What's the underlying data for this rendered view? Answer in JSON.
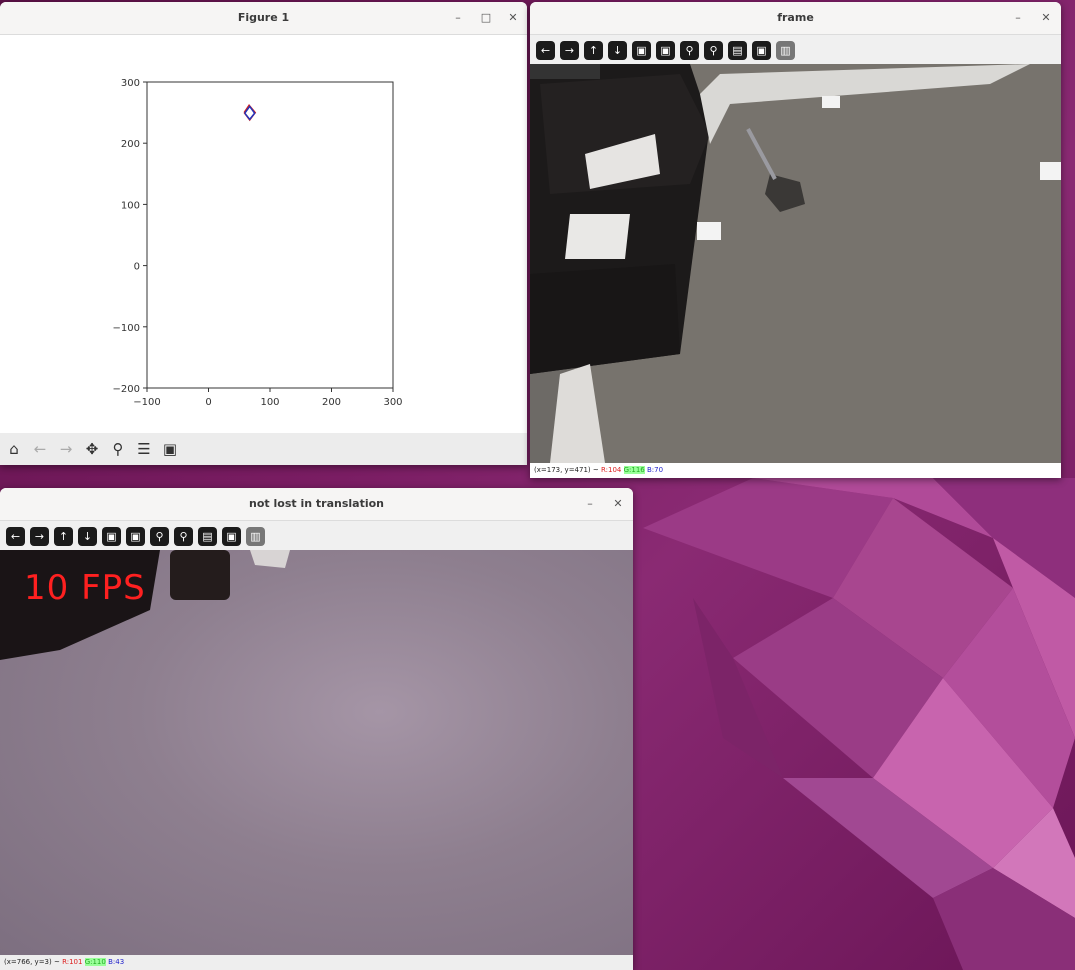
{
  "figure": {
    "title": "Figure 1",
    "controls": {
      "minimize": "–",
      "maximize": "□",
      "close": "✕"
    },
    "toolbar": [
      "home-icon",
      "back-icon",
      "forward-icon",
      "pan-icon",
      "zoom-icon",
      "configure-icon",
      "save-icon"
    ]
  },
  "chart_data": {
    "type": "line",
    "x_ticks": [
      "−100",
      "0",
      "100",
      "200",
      "300"
    ],
    "y_ticks": [
      "300",
      "200",
      "100",
      "0",
      "−100",
      "−200"
    ],
    "xlim": [
      -100,
      300
    ],
    "ylim": [
      -200,
      300
    ],
    "series": [
      {
        "color": "#cc2222",
        "x": [
          58,
          66,
          76,
          67,
          58
        ],
        "y": [
          250,
          262,
          250,
          238,
          250
        ]
      },
      {
        "color": "#2233bb",
        "x": [
          59,
          67,
          75,
          67,
          59
        ],
        "y": [
          249,
          260,
          249,
          239,
          249
        ]
      }
    ]
  },
  "frame": {
    "title": "frame",
    "controls": {
      "minimize": "–",
      "close": "✕"
    },
    "tools": [
      "←",
      "→",
      "↑",
      "↓",
      "▣",
      "▣",
      "⚲",
      "⚲",
      "▤",
      "▣",
      "▥"
    ],
    "status": {
      "coords": "(x=173, y=471) ~",
      "r": "R:104",
      "g": "G:116",
      "b": "B:70"
    }
  },
  "nlt": {
    "title": "not lost in translation",
    "controls": {
      "minimize": "–",
      "close": "✕"
    },
    "tools": [
      "←",
      "→",
      "↑",
      "↓",
      "▣",
      "▣",
      "⚲",
      "⚲",
      "▤",
      "▣",
      "▥"
    ],
    "fps": "10 FPS",
    "status": {
      "coords": "(x=766, y=3) ~",
      "r": "R:101",
      "g": "G:110",
      "b": "B:43"
    }
  },
  "colors": {
    "wallpaper": "#7a1d63",
    "fps": "#ff2020"
  }
}
